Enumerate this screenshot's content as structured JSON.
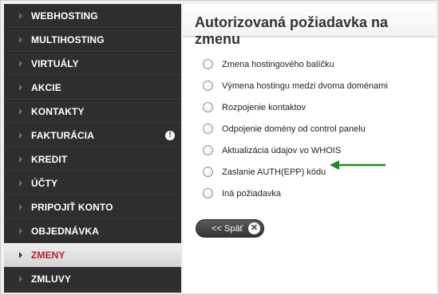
{
  "sidebar": {
    "items": [
      {
        "label": "WEBHOSTING"
      },
      {
        "label": "MULTIHOSTING"
      },
      {
        "label": "VIRTUÁLY"
      },
      {
        "label": "AKCIE"
      },
      {
        "label": "KONTAKTY"
      },
      {
        "label": "FAKTURÁCIA",
        "alert": "!"
      },
      {
        "label": "KREDIT"
      },
      {
        "label": "ÚČTY"
      },
      {
        "label": "PRIPOJIŤ KONTO"
      },
      {
        "label": "OBJEDNÁVKA"
      },
      {
        "label": "ZMENY"
      },
      {
        "label": "ZMLUVY"
      }
    ],
    "active_color": "#b81c2c"
  },
  "panel": {
    "title": "Autorizovaná požiadavka na zmenu",
    "options": [
      {
        "label": "Zmena hostingového balíčku"
      },
      {
        "label": "Výmena hostingu medzi dvoma doménami"
      },
      {
        "label": "Rozpojenie kontaktov"
      },
      {
        "label": "Odpojenie domény od control panelu"
      },
      {
        "label": "Aktualizácia údajov vo WHOIS"
      },
      {
        "label": "Zaslanie AUTH(EPP) kódu"
      },
      {
        "label": "Iná požiadavka"
      }
    ],
    "annotation_arrow_color": "#1e8a1e",
    "back_button": {
      "label": "<< Späť",
      "close_glyph": "✕"
    }
  }
}
